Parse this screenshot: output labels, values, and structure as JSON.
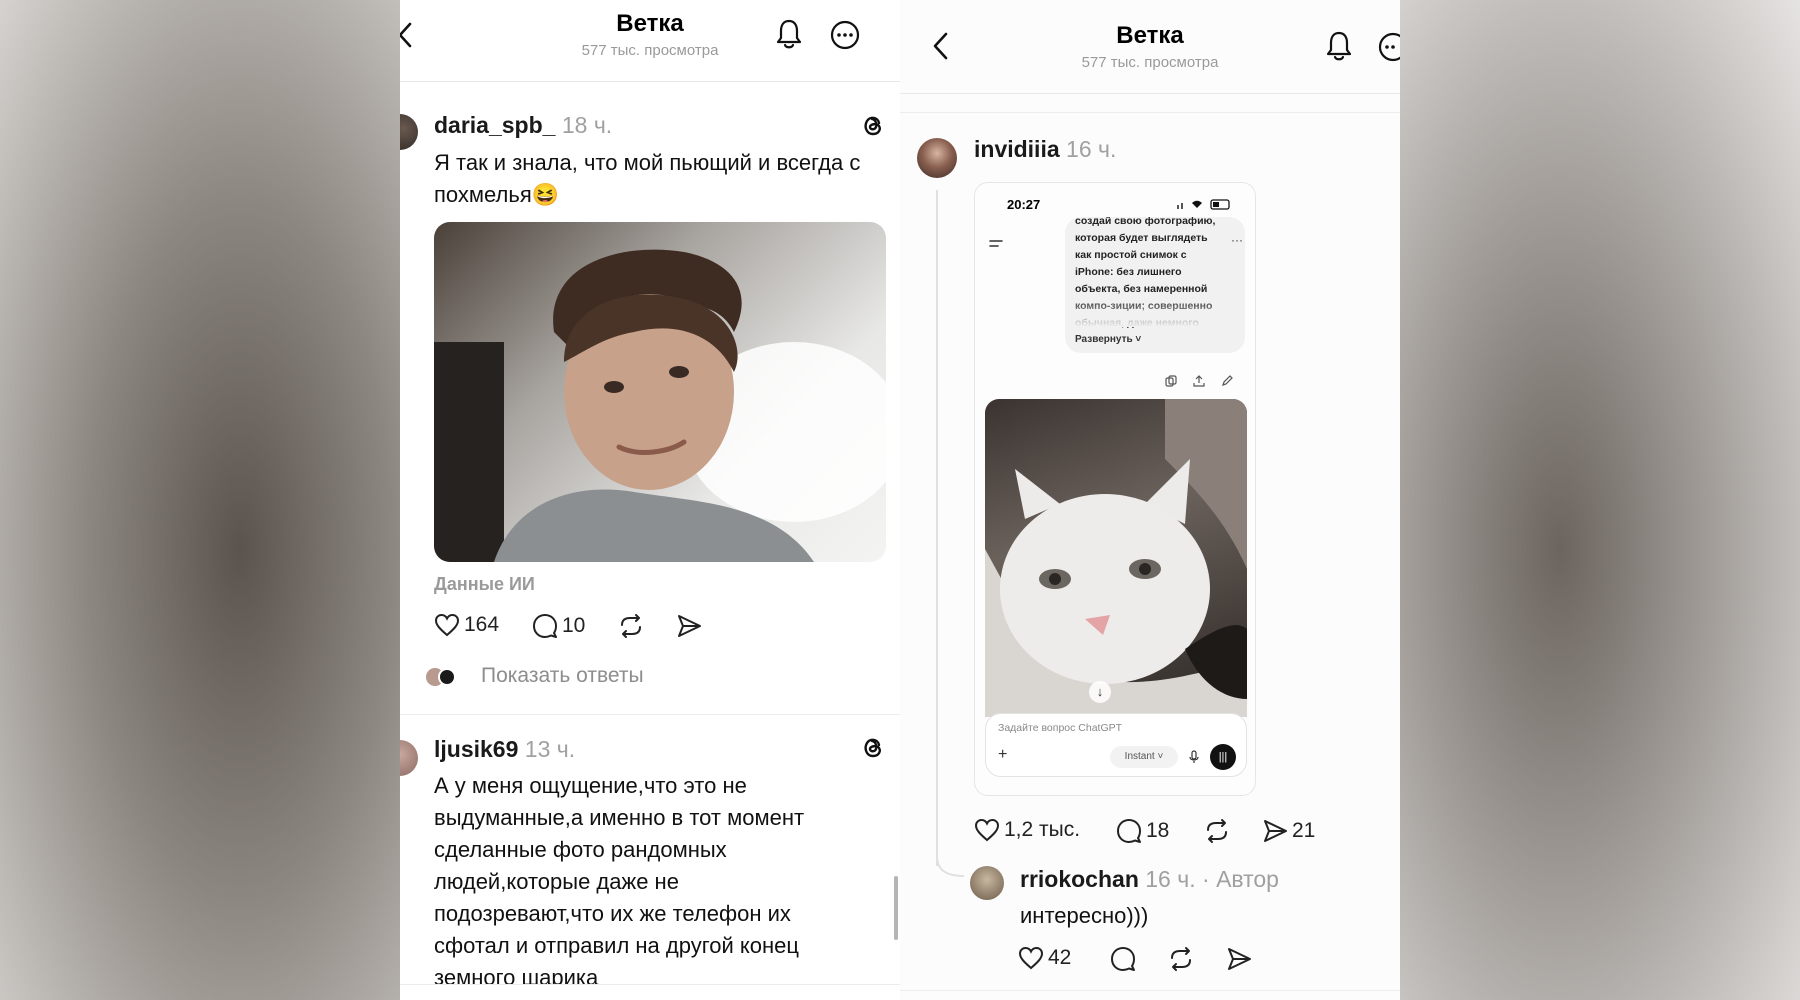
{
  "left": {
    "header": {
      "title": "Ветка",
      "subtitle": "577 тыс. просмотра"
    },
    "post": {
      "username": "daria_spb_",
      "time": "18 ч.",
      "text": "Я так и знала, что мой пьющий и всегда с похмелья😆",
      "ai_label": "Данные ИИ",
      "likes": "164",
      "comments": "10",
      "show_replies": "Показать ответы"
    },
    "post2": {
      "username": "ljusik69",
      "time": "13 ч.",
      "text": "А у меня ощущение,что это не выдуманные,а именно в тот момент сделанные фото рандомных людей,которые даже не подозревают,что их же телефон их сфотал и отправил на другой конец земного шарика"
    }
  },
  "right": {
    "header": {
      "title": "Ветка",
      "subtitle": "577 тыс. просмотра"
    },
    "post": {
      "username": "invidiiia",
      "time": "16 ч.",
      "likes": "1,2 тыс.",
      "comments": "18",
      "shares": "21"
    },
    "screenshot": {
      "time": "20:27",
      "prompt_text": "создай свою фотографию, которая будет выглядеть как простой снимок с iPhone: без лишнего объекта, без намеренной компо-зиции; совершенно обычная, даже немного",
      "expand_label": "Развернуть",
      "input_placeholder": "Задайте вопрос ChatGPT",
      "mode_label": "Instant"
    },
    "reply": {
      "username": "rriokochan",
      "time": "16 ч.",
      "author_tag": "· Автор",
      "text": "интересно)))",
      "likes": "42"
    }
  }
}
